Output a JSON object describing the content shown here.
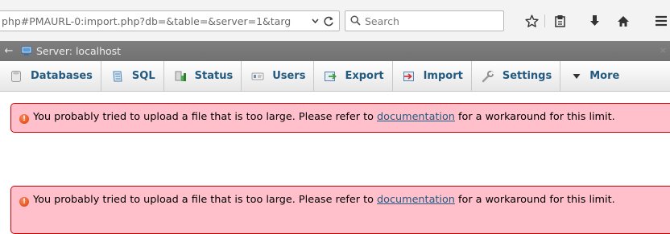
{
  "browser": {
    "url": "php#PMAURL-0:import.php?db=&table=&server=1&targ",
    "search_placeholder": "Search",
    "icons": [
      "url-dropdown-icon",
      "reload-icon",
      "search-icon",
      "bookmark-star-icon",
      "reading-list-icon",
      "download-icon",
      "home-icon",
      "hamburger-menu-icon"
    ]
  },
  "server_bar": {
    "back_arrow": "←",
    "label": "Server: localhost",
    "close": "×"
  },
  "menu": {
    "tabs": [
      {
        "label": "Databases",
        "icon": "databases-icon"
      },
      {
        "label": "SQL",
        "icon": "sql-icon"
      },
      {
        "label": "Status",
        "icon": "status-icon"
      },
      {
        "label": "Users",
        "icon": "users-icon"
      },
      {
        "label": "Export",
        "icon": "export-icon"
      },
      {
        "label": "Import",
        "icon": "import-icon"
      },
      {
        "label": "Settings",
        "icon": "settings-icon"
      },
      {
        "label": "More",
        "icon": "more-dropdown-icon"
      }
    ]
  },
  "errors": [
    {
      "icon": "error-icon",
      "text_before": "You probably tried to upload a file that is too large. Please refer to ",
      "link_text": "documentation",
      "text_after": " for a workaround for this limit."
    },
    {
      "icon": "error-icon",
      "text_before": "You probably tried to upload a file that is too large. Please refer to ",
      "link_text": "documentation",
      "text_after": " for a workaround for this limit."
    }
  ],
  "colors": {
    "menu_text": "#235a81",
    "error_bg": "#ffc0cb",
    "error_border": "#cc0000",
    "server_bar": "#777777"
  }
}
